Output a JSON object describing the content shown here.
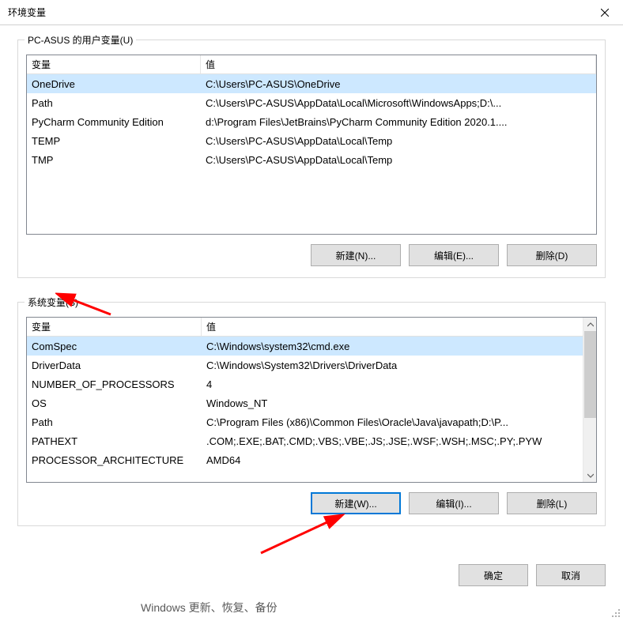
{
  "window": {
    "title": "环境变量",
    "close_label": "Close"
  },
  "user_vars_group": {
    "label": "PC-ASUS 的用户变量(U)",
    "headers": {
      "variable": "变量",
      "value": "值"
    },
    "rows": [
      {
        "variable": "OneDrive",
        "value": "C:\\Users\\PC-ASUS\\OneDrive"
      },
      {
        "variable": "Path",
        "value": "C:\\Users\\PC-ASUS\\AppData\\Local\\Microsoft\\WindowsApps;D:\\..."
      },
      {
        "variable": "PyCharm Community Edition",
        "value": "d:\\Program Files\\JetBrains\\PyCharm Community Edition 2020.1...."
      },
      {
        "variable": "TEMP",
        "value": "C:\\Users\\PC-ASUS\\AppData\\Local\\Temp"
      },
      {
        "variable": "TMP",
        "value": "C:\\Users\\PC-ASUS\\AppData\\Local\\Temp"
      }
    ],
    "buttons": {
      "new": "新建(N)...",
      "edit": "编辑(E)...",
      "delete": "删除(D)"
    }
  },
  "system_vars_group": {
    "label": "系统变量(S)",
    "headers": {
      "variable": "变量",
      "value": "值"
    },
    "rows": [
      {
        "variable": "ComSpec",
        "value": "C:\\Windows\\system32\\cmd.exe"
      },
      {
        "variable": "DriverData",
        "value": "C:\\Windows\\System32\\Drivers\\DriverData"
      },
      {
        "variable": "NUMBER_OF_PROCESSORS",
        "value": "4"
      },
      {
        "variable": "OS",
        "value": "Windows_NT"
      },
      {
        "variable": "Path",
        "value": "C:\\Program Files (x86)\\Common Files\\Oracle\\Java\\javapath;D:\\P..."
      },
      {
        "variable": "PATHEXT",
        "value": ".COM;.EXE;.BAT;.CMD;.VBS;.VBE;.JS;.JSE;.WSF;.WSH;.MSC;.PY;.PYW"
      },
      {
        "variable": "PROCESSOR_ARCHITECTURE",
        "value": "AMD64"
      }
    ],
    "buttons": {
      "new": "新建(W)...",
      "edit": "编辑(I)...",
      "delete": "删除(L)"
    }
  },
  "dialog_buttons": {
    "ok": "确定",
    "cancel": "取消"
  },
  "partial_footer": "Windows 更新、恢复、备份"
}
